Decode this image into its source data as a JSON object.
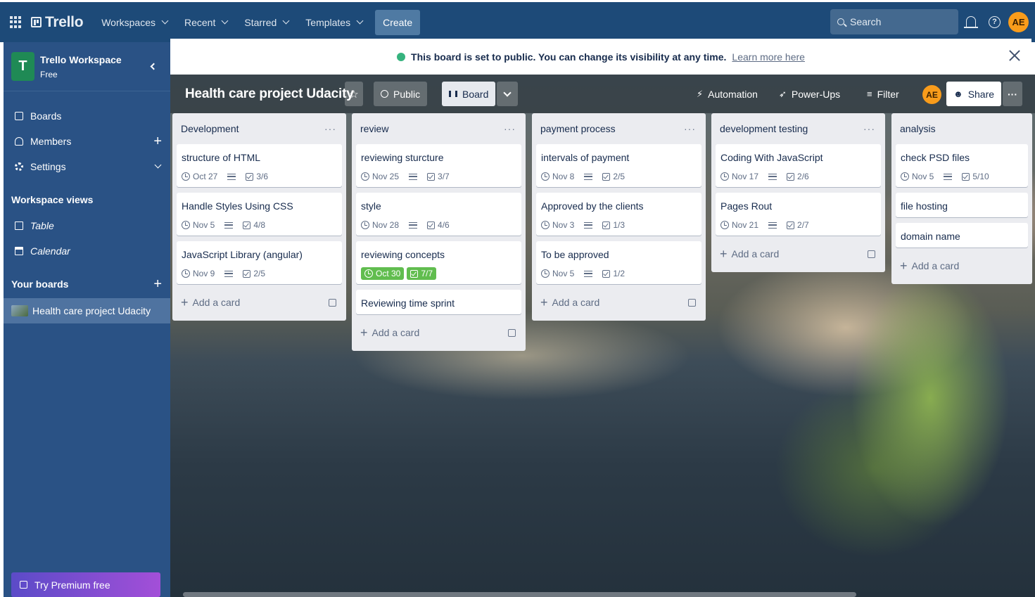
{
  "nav": {
    "brand": "Trello",
    "items": [
      "Workspaces",
      "Recent",
      "Starred",
      "Templates"
    ],
    "create": "Create",
    "search_placeholder": "Search",
    "avatar_initials": "AE"
  },
  "sidebar": {
    "workspace_initial": "T",
    "workspace_name": "Trello Workspace",
    "workspace_plan": "Free",
    "items": [
      "Boards",
      "Members",
      "Settings"
    ],
    "views_heading": "Workspace views",
    "views": [
      "Table",
      "Calendar"
    ],
    "your_boards": "Your boards",
    "active_board": "Health care project Udacity",
    "premium": "Try Premium free"
  },
  "banner": {
    "text": "This board is set to public. You can change its visibility at any time.",
    "link": "Learn more here"
  },
  "board": {
    "title": "Health care project Udacity",
    "visibility": "Public",
    "view": "Board",
    "automation": "Automation",
    "powerups": "Power-Ups",
    "filter": "Filter",
    "member_initials": "AE",
    "share": "Share"
  },
  "lists": [
    {
      "name": "Development",
      "cards": [
        {
          "title": "structure of HTML",
          "date": "Oct 27",
          "checklist": "3/6"
        },
        {
          "title": "Handle Styles Using CSS",
          "date": "Nov 5",
          "checklist": "4/8"
        },
        {
          "title": "JavaScript Library (angular)",
          "date": "Nov 9",
          "checklist": "2/5"
        }
      ],
      "add": "Add a card"
    },
    {
      "name": "review",
      "cards": [
        {
          "title": "reviewing sturcture",
          "date": "Nov 25",
          "checklist": "3/7"
        },
        {
          "title": "style",
          "date": "Nov 28",
          "checklist": "4/6"
        },
        {
          "title": "reviewing concepts",
          "date": "Oct 30",
          "checklist": "7/7"
        },
        {
          "title": "Reviewing time sprint"
        }
      ],
      "add": "Add a card"
    },
    {
      "name": "payment process",
      "cards": [
        {
          "title": "intervals of payment",
          "date": "Nov 8",
          "checklist": "2/5"
        },
        {
          "title": "Approved by the clients",
          "date": "Nov 3",
          "checklist": "1/3"
        },
        {
          "title": "To be approved",
          "date": "Nov 5",
          "checklist": "1/2"
        }
      ],
      "add": "Add a card"
    },
    {
      "name": "development testing",
      "cards": [
        {
          "title": "Coding With JavaScript",
          "date": "Nov 17",
          "checklist": "2/6"
        },
        {
          "title": "Pages Rout",
          "date": "Nov 21",
          "checklist": "2/7"
        }
      ],
      "add": "Add a card"
    },
    {
      "name": "analysis",
      "cards": [
        {
          "title": "check PSD files",
          "date": "Nov 5",
          "checklist": "5/10"
        },
        {
          "title": "file hosting"
        },
        {
          "title": "domain name"
        }
      ],
      "add": "Add a card"
    }
  ],
  "colors": {
    "nav_bg": "#1d4a78",
    "sidebar_bg": "#2a5285",
    "list_bg": "#ebecf0",
    "complete_badge": "#61bd4f",
    "avatar": "#f99c1b"
  }
}
